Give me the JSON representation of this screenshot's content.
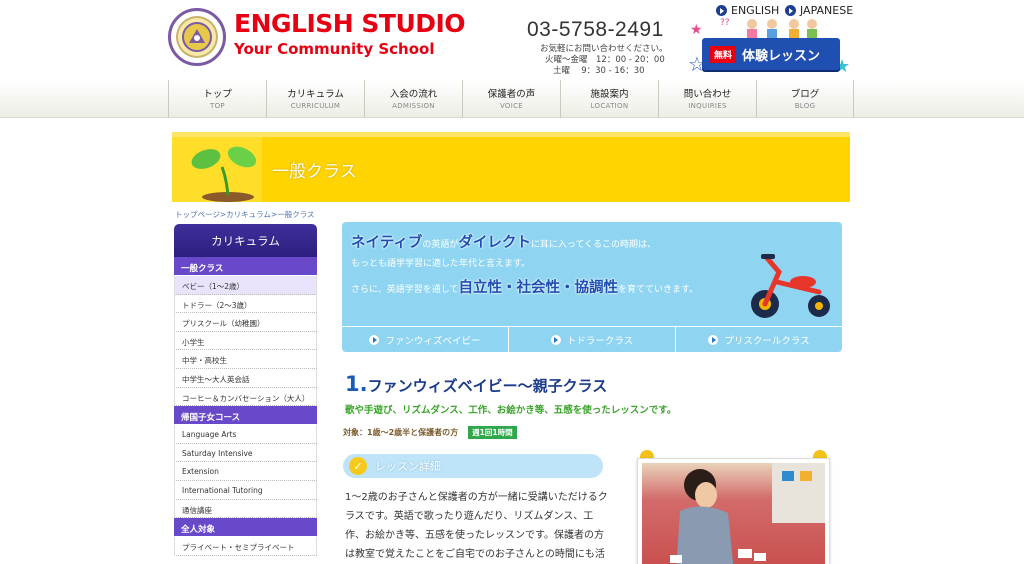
{
  "header": {
    "logo_title": "ENGLISH STUDIO",
    "logo_sub": "Your Community School",
    "phone": "03-5758-2491",
    "hours": [
      "お気軽にお問い合わせください。",
      "火曜〜金曜　12：00 - 20：00",
      "土曜　 9：30 - 16：30"
    ],
    "lang_en": "ENGLISH",
    "lang_ja": "JAPANESE",
    "trial_free": "無料",
    "trial_label": "体験レッスン"
  },
  "nav": [
    {
      "ja": "トップ",
      "en": "TOP"
    },
    {
      "ja": "カリキュラム",
      "en": "CURRICULUM"
    },
    {
      "ja": "入会の流れ",
      "en": "ADMISSION"
    },
    {
      "ja": "保護者の声",
      "en": "VOICE"
    },
    {
      "ja": "施設案内",
      "en": "LOCATION"
    },
    {
      "ja": "問い合わせ",
      "en": "INQUIRIES"
    },
    {
      "ja": "ブログ",
      "en": "BLOG"
    }
  ],
  "banner_title": "一般クラス",
  "breadcrumb": "トップページ>カリキュラム>一般クラス",
  "sidebar": {
    "title": "カリキュラム",
    "cat1": "一般クラス",
    "items1": [
      "ベビー（1〜2歳）",
      "トドラー（2〜3歳）",
      "プリスクール（幼稚園）",
      "小学生",
      "中学・高校生",
      "中学生〜大人英会話",
      "コーヒー＆カンバセーション（大人）"
    ],
    "cat2": "帰国子女コース",
    "items2": [
      "Language Arts",
      "Saturday Intensive",
      "Extension",
      "International Tutoring",
      "通信講座"
    ],
    "cat3": "全人対象",
    "items3": [
      "プライベート・セミプライベート"
    ]
  },
  "info": {
    "l1a": "ネイティブ",
    "l1b": "の英語が",
    "l1c": "ダイレクト",
    "l1d": "に耳に入ってくるこの時期は、",
    "l2": "もっとも語学学習に適した年代と言えます。",
    "l3a": "さらに、英語学習を通して",
    "l3b": "自立性・社会性・協調性",
    "l3c": "を育てていきます。",
    "tabs": [
      "ファンウィズベイビー",
      "トドラークラス",
      "プリスクールクラス"
    ]
  },
  "section": {
    "num": "1.",
    "title": "ファンウィズベイビー〜親子クラス",
    "subtitle": "歌や手遊び、リズムダンス、工作、お絵かき等、五感を使ったレッスンです。",
    "target": "対象：1歳〜2歳半と保護者の方",
    "badge": "週1回1時間",
    "detail_label": "レッスン詳細",
    "body": "1〜2歳のお子さんと保護者の方が一緒に受講いただけるクラスです。英語で歌ったり遊んだり、リズムダンス、工作、お絵かき等、五感を使ったレッスンです。保護者の方は教室で覚えたことをご自宅でのお子さんとの時間にも活"
  },
  "colors": {
    "accent": "#e60012",
    "brand_blue": "#1f4fb0",
    "banner": "#ffd400",
    "sidebar_cat": "#6849c9",
    "info_bg": "#8fd5f2"
  }
}
